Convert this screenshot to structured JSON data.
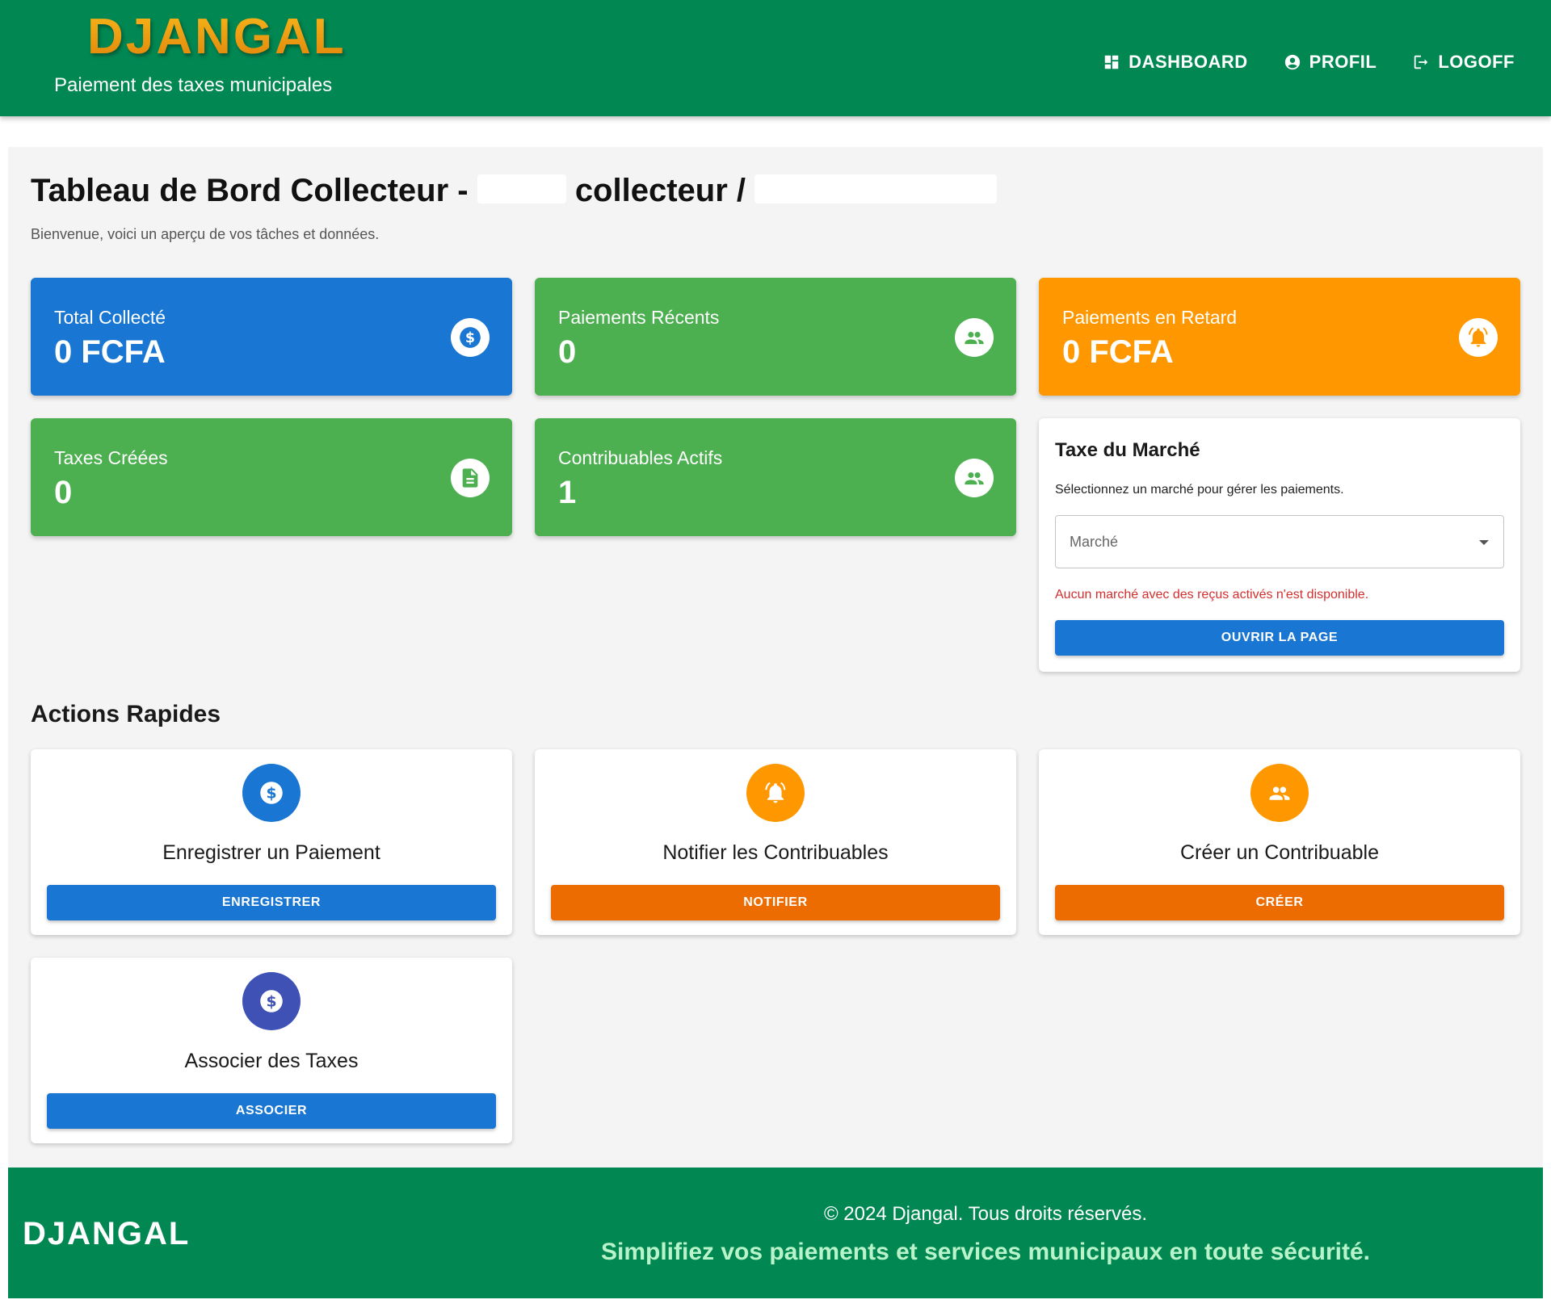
{
  "header": {
    "brand": "DJANGAL",
    "tagline": "Paiement des taxes municipales",
    "nav": [
      {
        "label": "DASHBOARD",
        "icon": "dashboard-icon"
      },
      {
        "label": "PROFIL",
        "icon": "account-circle-icon"
      },
      {
        "label": "LOGOFF",
        "icon": "logout-icon"
      }
    ]
  },
  "page": {
    "title_prefix": "Tableau de Bord Collecteur -",
    "title_middle": "collecteur /",
    "subtitle": "Bienvenue, voici un aperçu de vos tâches et données."
  },
  "stats": [
    {
      "label": "Total Collecté",
      "value": "0 FCFA",
      "icon": "dollar-icon",
      "color": "#1976d2"
    },
    {
      "label": "Paiements Récents",
      "value": "0",
      "icon": "people-icon",
      "color": "#4caf50"
    },
    {
      "label": "Paiements en Retard",
      "value": "0 FCFA",
      "icon": "alarm-bell-icon",
      "color": "#ff9800"
    },
    {
      "label": "Taxes Créées",
      "value": "0",
      "icon": "document-icon",
      "color": "#4caf50"
    },
    {
      "label": "Contribuables Actifs",
      "value": "1",
      "icon": "people-icon",
      "color": "#4caf50"
    }
  ],
  "market": {
    "title": "Taxe du Marché",
    "description": "Sélectionnez un marché pour gérer les paiements.",
    "select_placeholder": "Marché",
    "error": "Aucun marché avec des reçus activés n'est disponible.",
    "button": "OUVRIR LA PAGE"
  },
  "actions": {
    "title": "Actions Rapides",
    "items": [
      {
        "name": "Enregistrer un Paiement",
        "button": "ENREGISTRER",
        "icon": "dollar-icon",
        "color": "#1976d2"
      },
      {
        "name": "Notifier les Contribuables",
        "button": "NOTIFIER",
        "icon": "alarm-bell-icon",
        "color": "#ff9800"
      },
      {
        "name": "Créer un Contribuable",
        "button": "CRÉER",
        "icon": "people-icon",
        "color": "#ff9800"
      },
      {
        "name": "Associer des Taxes",
        "button": "ASSOCIER",
        "icon": "dollar-icon",
        "color": "#3f51b5"
      }
    ]
  },
  "footer": {
    "brand": "DJANGAL",
    "copyright": "© 2024 Djangal. Tous droits réservés.",
    "slogan": "Simplifiez vos paiements et services municipaux en toute sécurité."
  }
}
